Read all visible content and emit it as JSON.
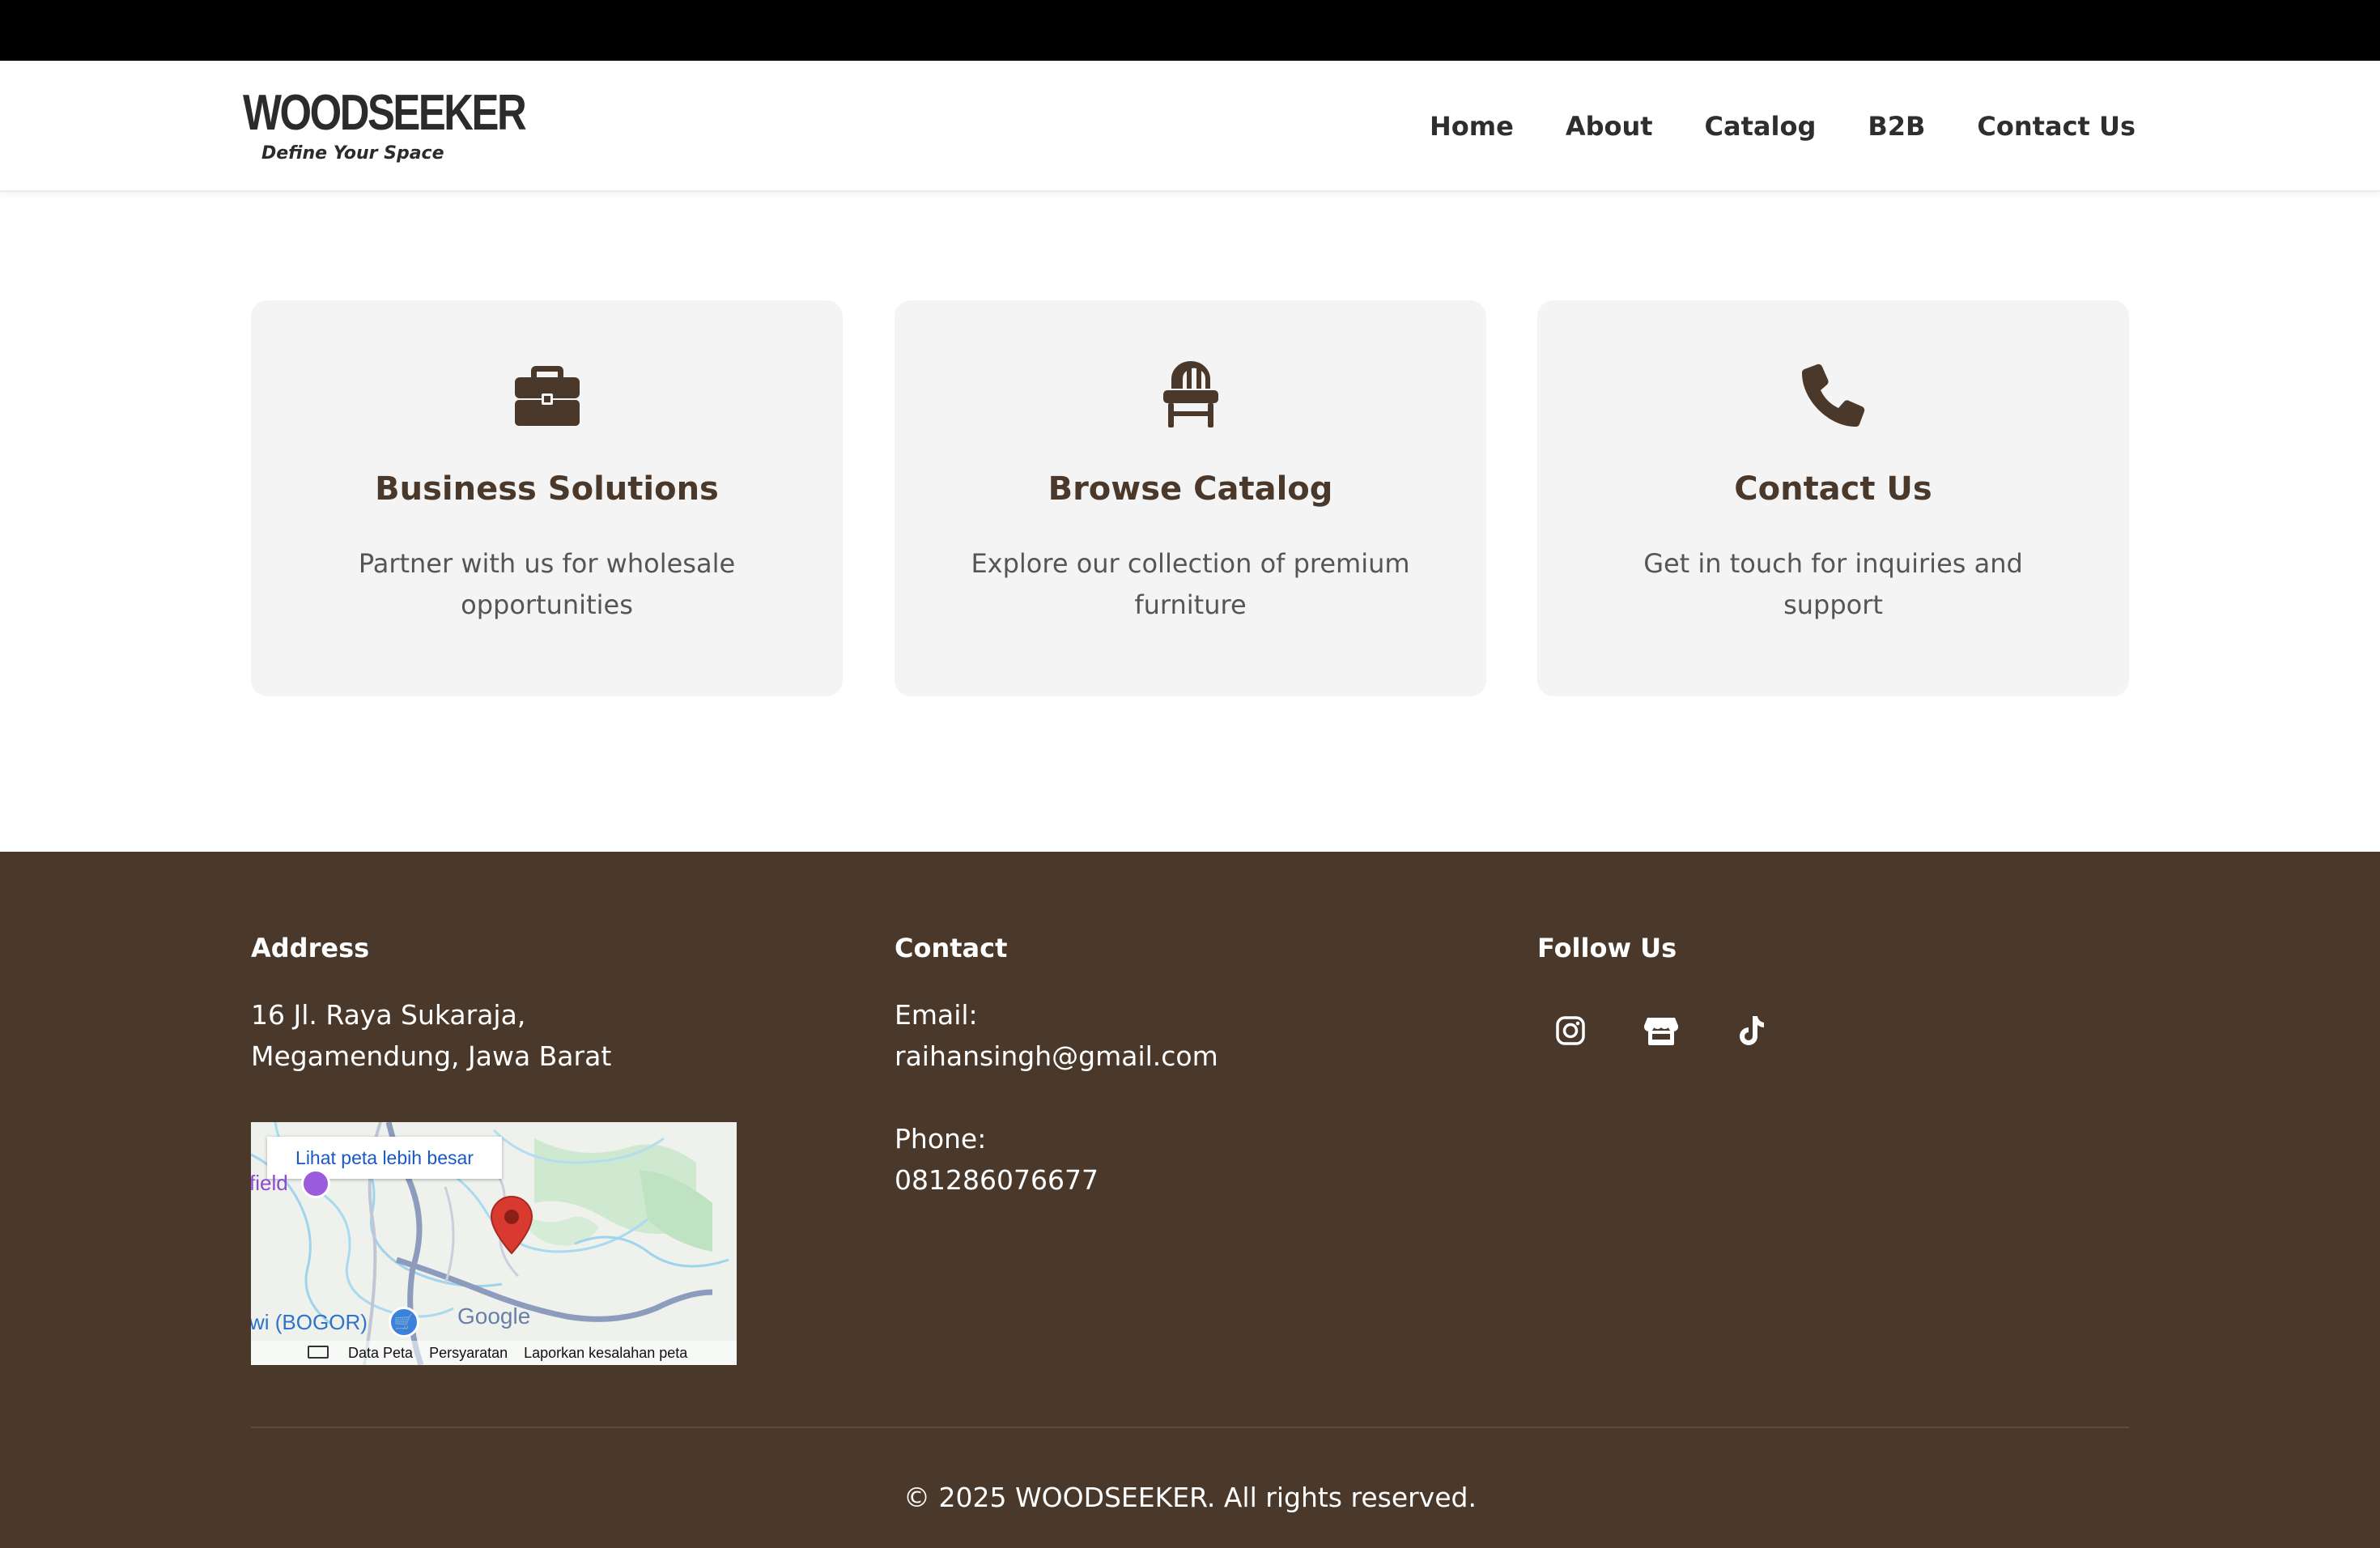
{
  "header": {
    "logo_name": "WOODSEEKER",
    "logo_tagline": "Define Your Space",
    "nav": [
      "Home",
      "About",
      "Catalog",
      "B2B",
      "Contact Us"
    ]
  },
  "cards": [
    {
      "icon": "briefcase-icon",
      "title": "Business Solutions",
      "description": "Partner with us for wholesale opportunities"
    },
    {
      "icon": "chair-icon",
      "title": "Browse Catalog",
      "description": "Explore our collection of premium furniture"
    },
    {
      "icon": "phone-icon",
      "title": "Contact Us",
      "description": "Get in touch for inquiries and support"
    }
  ],
  "footer": {
    "address": {
      "heading": "Address",
      "line1": "16 Jl. Raya Sukaraja,",
      "line2": "Megamendung, Jawa Barat"
    },
    "map": {
      "link": "Lihat peta lebih besar",
      "place_left": "field",
      "place_bottom": "wi (BOGOR)",
      "brand": "Google",
      "attributions": [
        "Data Peta",
        "Persyaratan",
        "Laporkan kesalahan peta"
      ]
    },
    "contact": {
      "heading": "Contact",
      "email_label": "Email:",
      "email": "raihansingh@gmail.com",
      "phone_label": "Phone:",
      "phone": "081286076677"
    },
    "follow": {
      "heading": "Follow Us",
      "icons": [
        "instagram-icon",
        "store-icon",
        "tiktok-icon"
      ]
    },
    "copyright": "© 2025 WOODSEEKER. All rights reserved."
  },
  "colors": {
    "brand_brown": "#4a392b",
    "card_bg": "#f4f4f4",
    "top_bar": "#000000"
  }
}
